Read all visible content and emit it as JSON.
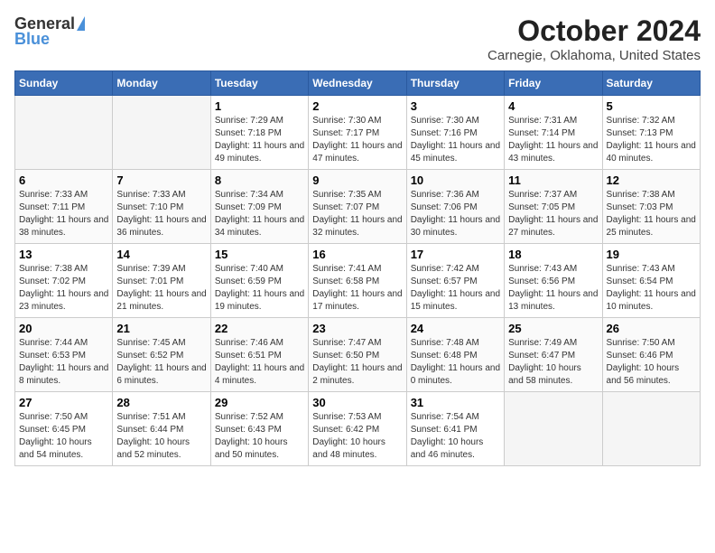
{
  "logo": {
    "general": "General",
    "blue": "Blue"
  },
  "title": "October 2024",
  "location": "Carnegie, Oklahoma, United States",
  "days_of_week": [
    "Sunday",
    "Monday",
    "Tuesday",
    "Wednesday",
    "Thursday",
    "Friday",
    "Saturday"
  ],
  "weeks": [
    [
      {
        "day": "",
        "info": ""
      },
      {
        "day": "",
        "info": ""
      },
      {
        "day": "1",
        "info": "Sunrise: 7:29 AM\nSunset: 7:18 PM\nDaylight: 11 hours and 49 minutes."
      },
      {
        "day": "2",
        "info": "Sunrise: 7:30 AM\nSunset: 7:17 PM\nDaylight: 11 hours and 47 minutes."
      },
      {
        "day": "3",
        "info": "Sunrise: 7:30 AM\nSunset: 7:16 PM\nDaylight: 11 hours and 45 minutes."
      },
      {
        "day": "4",
        "info": "Sunrise: 7:31 AM\nSunset: 7:14 PM\nDaylight: 11 hours and 43 minutes."
      },
      {
        "day": "5",
        "info": "Sunrise: 7:32 AM\nSunset: 7:13 PM\nDaylight: 11 hours and 40 minutes."
      }
    ],
    [
      {
        "day": "6",
        "info": "Sunrise: 7:33 AM\nSunset: 7:11 PM\nDaylight: 11 hours and 38 minutes."
      },
      {
        "day": "7",
        "info": "Sunrise: 7:33 AM\nSunset: 7:10 PM\nDaylight: 11 hours and 36 minutes."
      },
      {
        "day": "8",
        "info": "Sunrise: 7:34 AM\nSunset: 7:09 PM\nDaylight: 11 hours and 34 minutes."
      },
      {
        "day": "9",
        "info": "Sunrise: 7:35 AM\nSunset: 7:07 PM\nDaylight: 11 hours and 32 minutes."
      },
      {
        "day": "10",
        "info": "Sunrise: 7:36 AM\nSunset: 7:06 PM\nDaylight: 11 hours and 30 minutes."
      },
      {
        "day": "11",
        "info": "Sunrise: 7:37 AM\nSunset: 7:05 PM\nDaylight: 11 hours and 27 minutes."
      },
      {
        "day": "12",
        "info": "Sunrise: 7:38 AM\nSunset: 7:03 PM\nDaylight: 11 hours and 25 minutes."
      }
    ],
    [
      {
        "day": "13",
        "info": "Sunrise: 7:38 AM\nSunset: 7:02 PM\nDaylight: 11 hours and 23 minutes."
      },
      {
        "day": "14",
        "info": "Sunrise: 7:39 AM\nSunset: 7:01 PM\nDaylight: 11 hours and 21 minutes."
      },
      {
        "day": "15",
        "info": "Sunrise: 7:40 AM\nSunset: 6:59 PM\nDaylight: 11 hours and 19 minutes."
      },
      {
        "day": "16",
        "info": "Sunrise: 7:41 AM\nSunset: 6:58 PM\nDaylight: 11 hours and 17 minutes."
      },
      {
        "day": "17",
        "info": "Sunrise: 7:42 AM\nSunset: 6:57 PM\nDaylight: 11 hours and 15 minutes."
      },
      {
        "day": "18",
        "info": "Sunrise: 7:43 AM\nSunset: 6:56 PM\nDaylight: 11 hours and 13 minutes."
      },
      {
        "day": "19",
        "info": "Sunrise: 7:43 AM\nSunset: 6:54 PM\nDaylight: 11 hours and 10 minutes."
      }
    ],
    [
      {
        "day": "20",
        "info": "Sunrise: 7:44 AM\nSunset: 6:53 PM\nDaylight: 11 hours and 8 minutes."
      },
      {
        "day": "21",
        "info": "Sunrise: 7:45 AM\nSunset: 6:52 PM\nDaylight: 11 hours and 6 minutes."
      },
      {
        "day": "22",
        "info": "Sunrise: 7:46 AM\nSunset: 6:51 PM\nDaylight: 11 hours and 4 minutes."
      },
      {
        "day": "23",
        "info": "Sunrise: 7:47 AM\nSunset: 6:50 PM\nDaylight: 11 hours and 2 minutes."
      },
      {
        "day": "24",
        "info": "Sunrise: 7:48 AM\nSunset: 6:48 PM\nDaylight: 11 hours and 0 minutes."
      },
      {
        "day": "25",
        "info": "Sunrise: 7:49 AM\nSunset: 6:47 PM\nDaylight: 10 hours and 58 minutes."
      },
      {
        "day": "26",
        "info": "Sunrise: 7:50 AM\nSunset: 6:46 PM\nDaylight: 10 hours and 56 minutes."
      }
    ],
    [
      {
        "day": "27",
        "info": "Sunrise: 7:50 AM\nSunset: 6:45 PM\nDaylight: 10 hours and 54 minutes."
      },
      {
        "day": "28",
        "info": "Sunrise: 7:51 AM\nSunset: 6:44 PM\nDaylight: 10 hours and 52 minutes."
      },
      {
        "day": "29",
        "info": "Sunrise: 7:52 AM\nSunset: 6:43 PM\nDaylight: 10 hours and 50 minutes."
      },
      {
        "day": "30",
        "info": "Sunrise: 7:53 AM\nSunset: 6:42 PM\nDaylight: 10 hours and 48 minutes."
      },
      {
        "day": "31",
        "info": "Sunrise: 7:54 AM\nSunset: 6:41 PM\nDaylight: 10 hours and 46 minutes."
      },
      {
        "day": "",
        "info": ""
      },
      {
        "day": "",
        "info": ""
      }
    ]
  ]
}
